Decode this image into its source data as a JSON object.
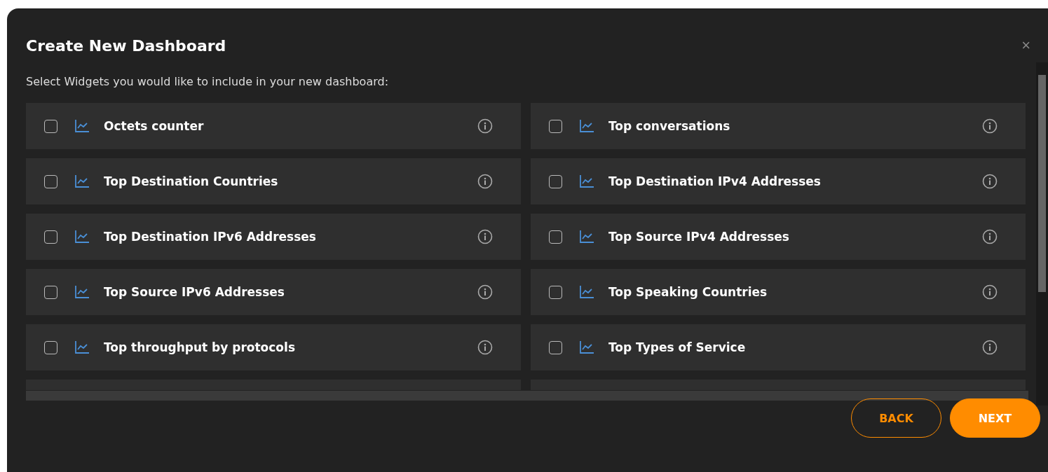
{
  "dialog": {
    "title": "Create New Dashboard",
    "close": "×",
    "instruction": "Select Widgets you would like to include in your new dashboard:"
  },
  "widgets": [
    {
      "label": "Octets counter",
      "checked": false
    },
    {
      "label": "Top conversations",
      "checked": false
    },
    {
      "label": "Top Destination Countries",
      "checked": false
    },
    {
      "label": "Top Destination IPv4 Addresses",
      "checked": false
    },
    {
      "label": "Top Destination IPv6 Addresses",
      "checked": false
    },
    {
      "label": "Top Source IPv4 Addresses",
      "checked": false
    },
    {
      "label": "Top Source IPv6 Addresses",
      "checked": false
    },
    {
      "label": "Top Speaking Countries",
      "checked": false
    },
    {
      "label": "Top throughput by protocols",
      "checked": false
    },
    {
      "label": "Top Types of Service",
      "checked": false
    }
  ],
  "buttons": [
    {
      "label": "BACK",
      "kind": "outline"
    },
    {
      "label": "NEXT",
      "kind": "filled"
    }
  ]
}
